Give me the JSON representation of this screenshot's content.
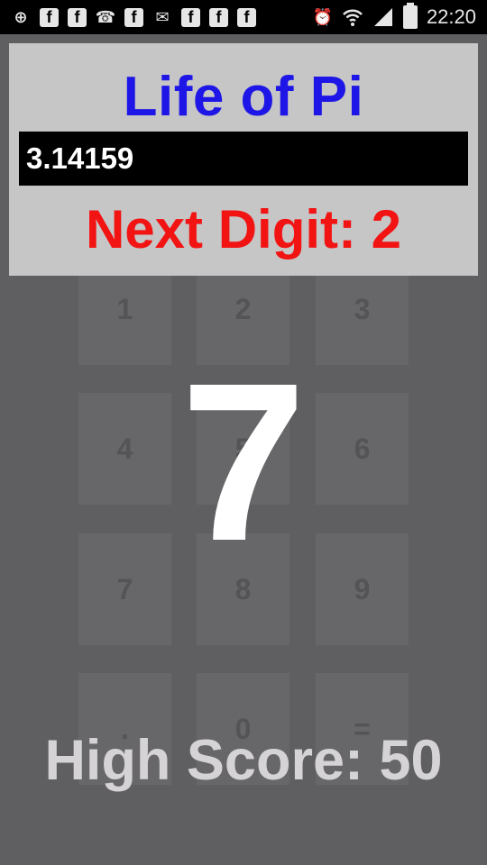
{
  "status_bar": {
    "time": "22:20",
    "icons": [
      "add-icon",
      "facebook-icon",
      "facebook-icon",
      "missed-call-icon",
      "facebook-icon",
      "mail-icon",
      "facebook-icon",
      "facebook-icon",
      "facebook-icon",
      "alarm-icon",
      "wifi-icon",
      "signal-icon",
      "battery-icon"
    ],
    "fb_glyph": "f"
  },
  "game": {
    "title": "Life of Pi",
    "digits_entered": "3.14159",
    "next_digit_text": "Next Digit: 2",
    "current_digit": "7",
    "high_score_text": "High Score: 50"
  },
  "keypad": {
    "keys": [
      "1",
      "2",
      "3",
      "4",
      "5",
      "6",
      "7",
      "8",
      "9",
      ".",
      "0",
      "="
    ]
  },
  "colors": {
    "title": "#1e16e6",
    "next_digit": "#f21313",
    "background": "#5f5f61",
    "header_panel": "#c6c6c6"
  }
}
